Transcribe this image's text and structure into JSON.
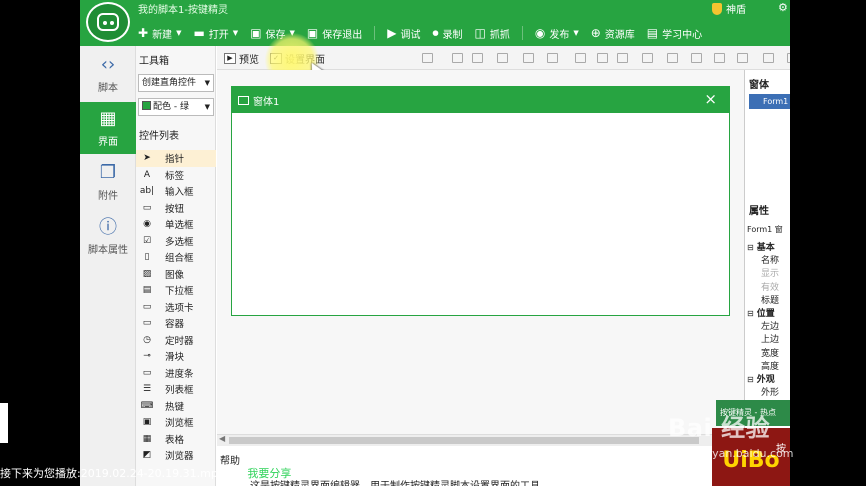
{
  "app": {
    "title": "我的脚本1-按键精灵",
    "user": "神盾",
    "gear_icon": "gear-icon"
  },
  "topmenu": [
    {
      "label": "新建",
      "icon": "plus-icon",
      "caret": true
    },
    {
      "label": "打开",
      "icon": "folder-icon",
      "caret": true
    },
    {
      "label": "保存",
      "icon": "save-icon",
      "caret": true
    },
    {
      "label": "保存退出",
      "icon": "save-exit-icon",
      "caret": false
    },
    {
      "label": "调试",
      "icon": "play-icon",
      "caret": false
    },
    {
      "label": "录制",
      "icon": "record-icon",
      "caret": false
    },
    {
      "label": "抓抓",
      "icon": "grab-icon",
      "caret": false
    },
    {
      "label": "发布",
      "icon": "publish-icon",
      "caret": true
    },
    {
      "label": "资源库",
      "icon": "library-icon",
      "caret": false
    },
    {
      "label": "学习中心",
      "icon": "learn-icon",
      "caret": false
    }
  ],
  "leftnav": [
    {
      "label": "脚本",
      "icon": "code-icon",
      "active": false
    },
    {
      "label": "界面",
      "icon": "grid-icon",
      "active": true
    },
    {
      "label": "附件",
      "icon": "attachment-icon",
      "active": false
    },
    {
      "label": "脚本属性",
      "icon": "info-icon",
      "active": false
    }
  ],
  "toolbox": {
    "title": "工具箱",
    "style_select": "创建直角控件",
    "color_select": "配色 - 绿",
    "list_label": "控件列表",
    "controls": [
      {
        "label": "指针",
        "icon": "pointer-icon",
        "selected": true
      },
      {
        "label": "标签",
        "icon": "label-icon"
      },
      {
        "label": "输入框",
        "icon": "input-icon"
      },
      {
        "label": "按钮",
        "icon": "button-icon"
      },
      {
        "label": "单选框",
        "icon": "radio-icon"
      },
      {
        "label": "多选框",
        "icon": "checkbox-icon"
      },
      {
        "label": "组合框",
        "icon": "combobox-icon"
      },
      {
        "label": "图像",
        "icon": "image-icon"
      },
      {
        "label": "下拉框",
        "icon": "dropdown-icon"
      },
      {
        "label": "选项卡",
        "icon": "tab-icon"
      },
      {
        "label": "容器",
        "icon": "container-icon"
      },
      {
        "label": "定时器",
        "icon": "timer-icon"
      },
      {
        "label": "滑块",
        "icon": "slider-icon"
      },
      {
        "label": "进度条",
        "icon": "progress-icon"
      },
      {
        "label": "列表框",
        "icon": "listbox-icon"
      },
      {
        "label": "热键",
        "icon": "hotkey-icon"
      },
      {
        "label": "浏览框",
        "icon": "browse-icon"
      },
      {
        "label": "表格",
        "icon": "table-icon"
      },
      {
        "label": "浏览器",
        "icon": "browser-icon"
      }
    ]
  },
  "toolbar2": {
    "preview": "预览",
    "settings": "设置界面"
  },
  "form": {
    "title": "窗体1",
    "close": "×"
  },
  "help": {
    "label": "帮助",
    "text": "这是按键精灵界面编辑器，用于制作按键精灵脚本设置界面的工具。"
  },
  "rightpanel": {
    "form_label": "窗体",
    "form_item": "Form1",
    "prop_label": "属性",
    "object": "Form1 窗",
    "groups": [
      {
        "name": "基本",
        "rows": [
          {
            "label": "名称"
          },
          {
            "label": "显示",
            "dim": true
          },
          {
            "label": "有效",
            "dim": true
          },
          {
            "label": "标题"
          }
        ]
      },
      {
        "name": "位置",
        "rows": [
          {
            "label": "左边"
          },
          {
            "label": "上边"
          },
          {
            "label": "宽度"
          },
          {
            "label": "高度"
          }
        ]
      },
      {
        "name": "外观",
        "rows": [
          {
            "label": "外形"
          }
        ]
      }
    ]
  },
  "overlay": {
    "toast": "按键精灵 - 热点",
    "promo": "UiBo",
    "promo_side": "按",
    "player_text": "接下来为您播放:2019.02.24-20.19.31.mp4 。",
    "player_tag": "我要分享",
    "player_close": "✕",
    "watermark": "Bai 经验",
    "watermark_sub": "jingyan.baidu.com"
  }
}
